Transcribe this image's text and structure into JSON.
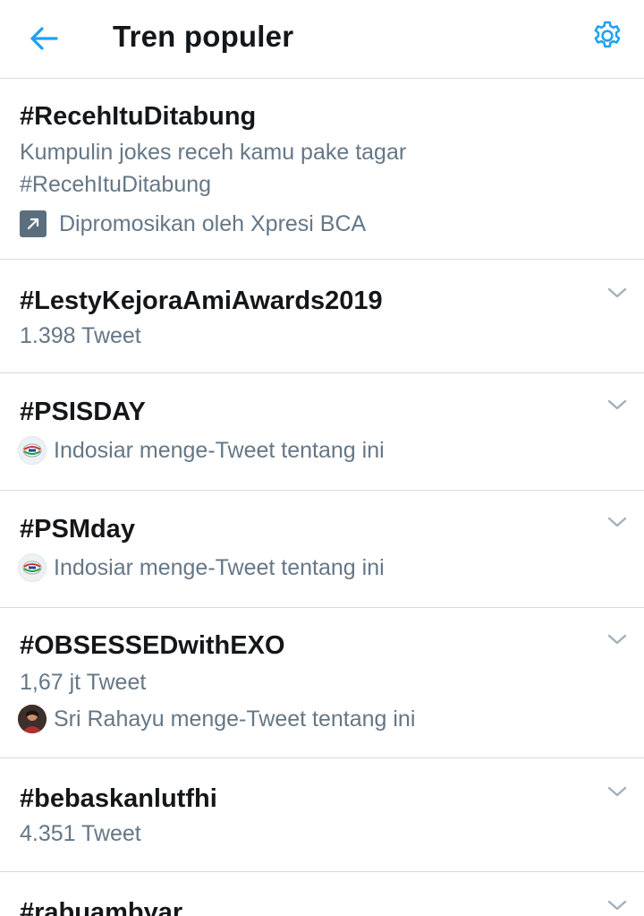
{
  "header": {
    "title": "Tren populer"
  },
  "colors": {
    "accent": "#1da1f2",
    "text_primary": "#14171a",
    "text_secondary": "#657786",
    "divider": "#d3dbe1"
  },
  "icons": {
    "back": "arrow-left-icon",
    "settings": "gear-icon",
    "promoted": "promoted-arrow-icon",
    "more": "chevron-down-icon"
  },
  "trends": [
    {
      "name": "#RecehItuDitabung",
      "description": "Kumpulin jokes receh kamu pake tagar #RecehItuDitabung",
      "context": "Dipromosikan oleh Xpresi BCA"
    },
    {
      "name": "#LestyKejoraAmiAwards2019",
      "tweet_count": "1.398 Tweet"
    },
    {
      "name": "#PSISDAY",
      "context": "Indosiar menge-Tweet tentang ini"
    },
    {
      "name": "#PSMday",
      "context": "Indosiar menge-Tweet tentang ini"
    },
    {
      "name": "#OBSESSEDwithEXO",
      "tweet_count": "1,67 jt Tweet",
      "context": "Sri Rahayu menge-Tweet tentang ini"
    },
    {
      "name": "#bebaskanlutfhi",
      "tweet_count": "4.351 Tweet"
    },
    {
      "name": "#rabuambyar"
    }
  ]
}
